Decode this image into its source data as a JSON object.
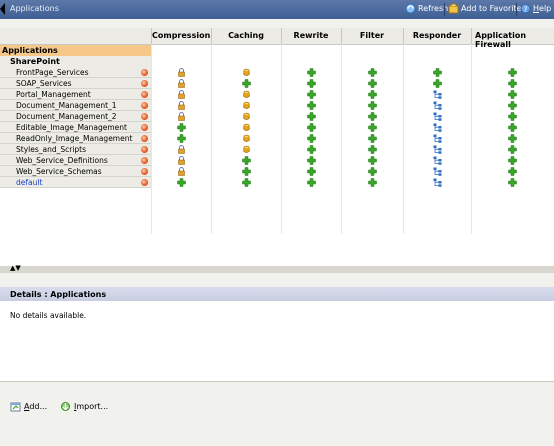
{
  "window": {
    "title": "Applications"
  },
  "toolbar": {
    "refresh": "Refresh",
    "add_favorites": "Add to Favorites",
    "help": "Help"
  },
  "grid": {
    "columns": [
      "Compression",
      "Caching",
      "Rewrite",
      "Filter",
      "Responder",
      "Application Firewall"
    ],
    "section": "Applications",
    "group": "SharePoint",
    "rows": [
      {
        "label": "FrontPage_Services",
        "cells": [
          "lock",
          "gold",
          "plus",
          "plus",
          "plus",
          "plus"
        ]
      },
      {
        "label": "SOAP_Services",
        "cells": [
          "lock",
          "plus",
          "plus",
          "plus",
          "plus",
          "plus"
        ]
      },
      {
        "label": "Portal_Management",
        "cells": [
          "lock",
          "gold",
          "plus",
          "plus",
          "tree",
          "plus"
        ]
      },
      {
        "label": "Document_Management_1",
        "cells": [
          "lock",
          "gold",
          "plus",
          "plus",
          "tree",
          "plus"
        ]
      },
      {
        "label": "Document_Management_2",
        "cells": [
          "lock",
          "gold",
          "plus",
          "plus",
          "tree",
          "plus"
        ]
      },
      {
        "label": "Editable_Image_Management",
        "cells": [
          "plus",
          "gold",
          "plus",
          "plus",
          "tree",
          "plus"
        ]
      },
      {
        "label": "ReadOnly_Image_Management",
        "cells": [
          "plus",
          "gold",
          "plus",
          "plus",
          "tree",
          "plus"
        ]
      },
      {
        "label": "Styles_and_Scripts",
        "cells": [
          "lock",
          "gold",
          "plus",
          "plus",
          "tree",
          "plus"
        ]
      },
      {
        "label": "Web_Service_Definitions",
        "cells": [
          "lock",
          "plus",
          "plus",
          "plus",
          "tree",
          "plus"
        ]
      },
      {
        "label": "Web_Service_Schemas",
        "cells": [
          "lock",
          "plus",
          "plus",
          "plus",
          "tree",
          "plus"
        ]
      },
      {
        "label": "default",
        "cells": [
          "plus",
          "plus",
          "plus",
          "plus",
          "tree",
          "plus"
        ]
      }
    ]
  },
  "details": {
    "title": "Details : Applications",
    "body": "No details available."
  },
  "actions": {
    "add": "Add...",
    "import": "Import..."
  },
  "colors": {
    "titlebar": "#4a6a9e",
    "section_highlight": "#f5c88a",
    "link": "#1c44c8",
    "plus": "#3aa52a",
    "tree": "#2d6fc4",
    "gold": "#e3a31b"
  }
}
